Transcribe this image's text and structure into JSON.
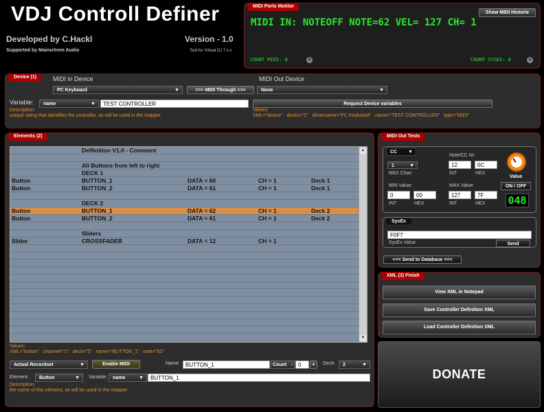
{
  "app": {
    "title": "VDJ Controll Definer",
    "developer": "Developed by C.Hackl",
    "supported": "Supported by Mainsrtrem Audio",
    "version": "Version - 1.0",
    "tagline": "Tool for Virtual DJ 7.x.x"
  },
  "midi_ports": {
    "tab": "MIDI Ports Motitor",
    "show_history": "Show MIDI Historie",
    "message": "MIDI IN: NOTEOFF NOTE=62 VEL= 127 CH= 1",
    "count_midi": "COUNT MIDI: 8",
    "count_sysex": "COUNT SYSEX: 0",
    "close_symbol": "✕"
  },
  "device": {
    "tab": "Device (1)",
    "midi_in_label": "MIDI in Device",
    "midi_in_value": "PC Keyboard",
    "midi_through": ">>> MIDI Through >>>",
    "midi_out_label": "MIDI Out Device",
    "midi_out_value": "None",
    "variable_label": "Variable:",
    "variable_value": "name",
    "variable_input": "TEST CONTROLLER",
    "request_button": "Request Device variables",
    "desc_label": "Description:",
    "desc_text": "unique string that identifies the controller, as will be used in the mapper",
    "values_label": "Values:",
    "values_text": "XML=\"device\"   decks=\"2\"   drivername=\"PC Keyboard\"   name=\"TEST CONTROLLER\"   type=\"MIDI\""
  },
  "elements": {
    "tab": "Elements (2)",
    "rows": [
      {
        "c1": "",
        "c2": "Deffinition V1.0 - Comment",
        "c3": "",
        "c4": "",
        "c5": ""
      },
      {
        "c1": "",
        "c2": "",
        "c3": "",
        "c4": "",
        "c5": ""
      },
      {
        "c1": "",
        "c2": "All Buttons from left to right",
        "c3": "",
        "c4": "",
        "c5": ""
      },
      {
        "c1": "",
        "c2": "DECK 1",
        "c3": "",
        "c4": "",
        "c5": ""
      },
      {
        "c1": "Button",
        "c2": "BUTTON_1",
        "c3": "DATA = 60",
        "c4": "CH = 1",
        "c5": "Deck 1"
      },
      {
        "c1": "Button",
        "c2": "BUTTON_2",
        "c3": "DATA = 61",
        "c4": "CH = 1",
        "c5": "Deck 1"
      },
      {
        "c1": "",
        "c2": "",
        "c3": "",
        "c4": "",
        "c5": ""
      },
      {
        "c1": "",
        "c2": "DECK 2",
        "c3": "",
        "c4": "",
        "c5": ""
      },
      {
        "c1": "Button",
        "c2": "BUTTON_1",
        "c3": "DATA = 62",
        "c4": "CH = 1",
        "c5": "Deck 2",
        "selected": true
      },
      {
        "c1": "Button",
        "c2": "BUTTON_2",
        "c3": "DATA = 61",
        "c4": "CH = 1",
        "c5": "Deck 2"
      },
      {
        "c1": "",
        "c2": "",
        "c3": "",
        "c4": "",
        "c5": ""
      },
      {
        "c1": "",
        "c2": "Sliders",
        "c3": "",
        "c4": "",
        "c5": ""
      },
      {
        "c1": "Slider",
        "c2": "CROSSFADER",
        "c3": "DATA = 12",
        "c4": "CH = 1",
        "c5": ""
      },
      {
        "c1": "",
        "c2": "",
        "c3": "",
        "c4": "",
        "c5": ""
      },
      {
        "c1": "",
        "c2": "",
        "c3": "",
        "c4": "",
        "c5": ""
      },
      {
        "c1": "",
        "c2": "",
        "c3": "",
        "c4": "",
        "c5": ""
      },
      {
        "c1": "",
        "c2": "",
        "c3": "",
        "c4": "",
        "c5": ""
      },
      {
        "c1": "",
        "c2": "",
        "c3": "",
        "c4": "",
        "c5": ""
      },
      {
        "c1": "",
        "c2": "",
        "c3": "",
        "c4": "",
        "c5": ""
      },
      {
        "c1": "",
        "c2": "",
        "c3": "",
        "c4": "",
        "c5": ""
      },
      {
        "c1": "",
        "c2": "",
        "c3": "",
        "c4": "",
        "c5": ""
      },
      {
        "c1": "",
        "c2": "",
        "c3": "",
        "c4": "",
        "c5": ""
      },
      {
        "c1": "",
        "c2": "",
        "c3": "",
        "c4": "",
        "c5": ""
      },
      {
        "c1": "",
        "c2": "",
        "c3": "",
        "c4": "",
        "c5": ""
      },
      {
        "c1": "",
        "c2": "",
        "c3": "",
        "c4": "",
        "c5": ""
      }
    ],
    "values_label": "Values:",
    "values_text": "XML=\"button\"   channel=\"1\"   deck=\"2\"   name=\"BUTTON_1\"   note=\"62\"",
    "recordset": "Actual Recordset",
    "enable_midi": "Enable MIDI",
    "name_label": "Name:",
    "name_value": "BUTTON_1",
    "count_label": "Count",
    "count_minus": "-",
    "count_value": "0",
    "count_plus": "+",
    "deck_label": "Deck:",
    "deck_value": "2",
    "element_label": "Element:",
    "element_value": "Button",
    "variable_label": "Variable:",
    "variable_value": "name",
    "variable_input": "BUTTON_1",
    "desc_label": "Description:",
    "desc_text": "the name of this element, as will be used in the mapper"
  },
  "midi_out": {
    "tab": "MIDI Out Tests",
    "type": "CC",
    "chan_value": "1",
    "chan_label": "MIDI Chan",
    "note_label": "Note/CC Nr:",
    "note_int": "12",
    "note_hex": "0C",
    "int_label": "INT",
    "hex_label": "HEX",
    "value_label": "Value",
    "onoff": "ON / OFF",
    "lcd_value": "048",
    "min_label": "MIN Value:",
    "min_int": "0",
    "min_hex": "00",
    "max_label": "MAX Value:",
    "max_int": "127",
    "max_hex": "7F",
    "sysex_tab": "SysEx",
    "sysex_value": "F0F7",
    "sysex_label": "SysEx Value",
    "send": "Send",
    "send_db": "<<< Send to Database <<<"
  },
  "xml": {
    "tab": "XML (3) Finish",
    "view": "View XML in Notepad",
    "save": "Save Controller Definition XML",
    "load": "Load Controller Definition XML"
  },
  "donate": "DONATE",
  "arrow_symbol": "▼",
  "colors": {
    "accent": "#aa0000",
    "lcd": "#2ee830",
    "orange": "#e8902a",
    "selected_row": "#d98e4a"
  }
}
